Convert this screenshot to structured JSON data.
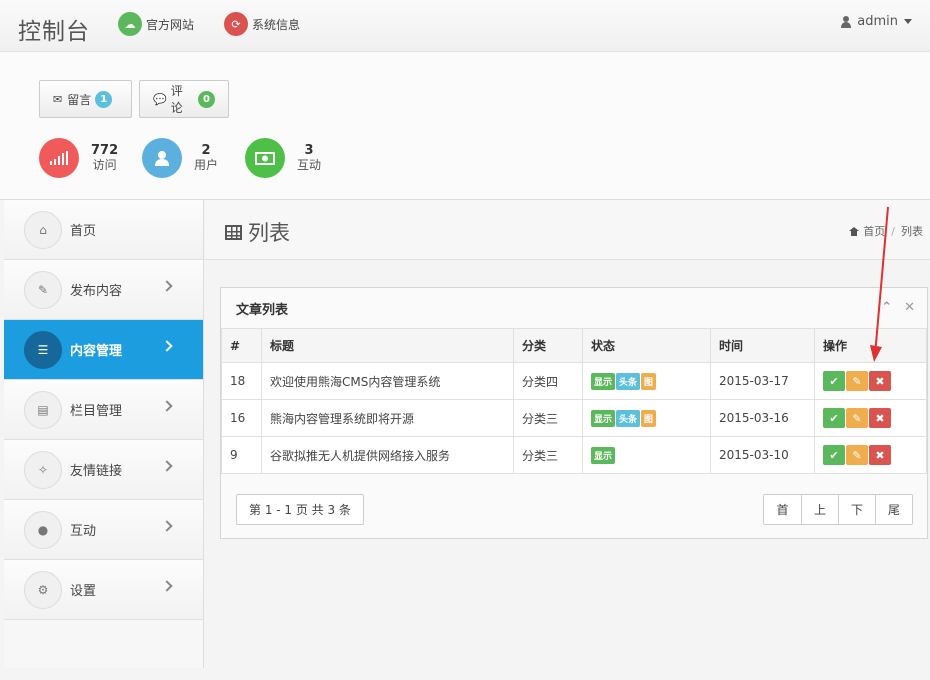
{
  "topbar": {
    "brand": "控制台",
    "links": [
      {
        "label": "官方网站",
        "icon": "cloud-upload-icon",
        "color": "#5cb85c"
      },
      {
        "label": "系统信息",
        "icon": "refresh-icon",
        "color": "#d9534f"
      }
    ],
    "user": "admin"
  },
  "header": {
    "buttons": [
      {
        "label": "留言",
        "icon": "envelope-icon",
        "count": "1",
        "badge_color": "#5bc0de"
      },
      {
        "label": "评论",
        "icon": "comments-icon",
        "count": "0",
        "badge_color": "#5cb85c"
      }
    ],
    "stats": [
      {
        "value": "772",
        "label": "访问",
        "icon": "signal-icon",
        "color": "#f05a5b"
      },
      {
        "value": "2",
        "label": "用户",
        "icon": "user-icon",
        "color": "#5bb0de"
      },
      {
        "value": "3",
        "label": "互动",
        "icon": "money-icon",
        "color": "#4ec048"
      }
    ]
  },
  "sidebar": {
    "items": [
      {
        "label": "首页",
        "icon": "home-icon",
        "active": false,
        "has_arrow": false
      },
      {
        "label": "发布内容",
        "icon": "pencil-icon",
        "active": false,
        "has_arrow": true
      },
      {
        "label": "内容管理",
        "icon": "list-icon",
        "active": true,
        "has_arrow": true
      },
      {
        "label": "栏目管理",
        "icon": "columns-icon",
        "active": false,
        "has_arrow": true
      },
      {
        "label": "友情链接",
        "icon": "magic-wand-icon",
        "active": false,
        "has_arrow": true
      },
      {
        "label": "互动",
        "icon": "comment-icon",
        "active": false,
        "has_arrow": true
      },
      {
        "label": "设置",
        "icon": "cogs-icon",
        "active": false,
        "has_arrow": true
      }
    ]
  },
  "main": {
    "title": "列表",
    "breadcrumb": {
      "home": "首页",
      "current": "列表"
    },
    "panel_title": "文章列表",
    "table": {
      "headers": [
        "#",
        "标题",
        "分类",
        "状态",
        "时间",
        "操作"
      ],
      "rows": [
        {
          "id": "18",
          "title": "欢迎使用熊海CMS内容管理系统",
          "category": "分类四",
          "tags": [
            "显示",
            "头条",
            "图"
          ],
          "time": "2015-03-17"
        },
        {
          "id": "16",
          "title": "熊海内容管理系统即将开源",
          "category": "分类三",
          "tags": [
            "显示",
            "头条",
            "图"
          ],
          "time": "2015-03-16"
        },
        {
          "id": "9",
          "title": "谷歌拟推无人机提供网络接入服务",
          "category": "分类三",
          "tags": [
            "显示"
          ],
          "time": "2015-03-10"
        }
      ]
    },
    "pager_info": "第 1 - 1 页 共 3 条",
    "pager": [
      "首",
      "上",
      "下",
      "尾"
    ]
  },
  "colors": {
    "tag_show": "#5cb85c",
    "tag_headline": "#5bc0de",
    "tag_image": "#f0ad4e",
    "action_ok": "#5cb85c",
    "action_edit": "#f0ad4e",
    "action_delete": "#d9534f",
    "annotation_arrow": "#e03030"
  }
}
